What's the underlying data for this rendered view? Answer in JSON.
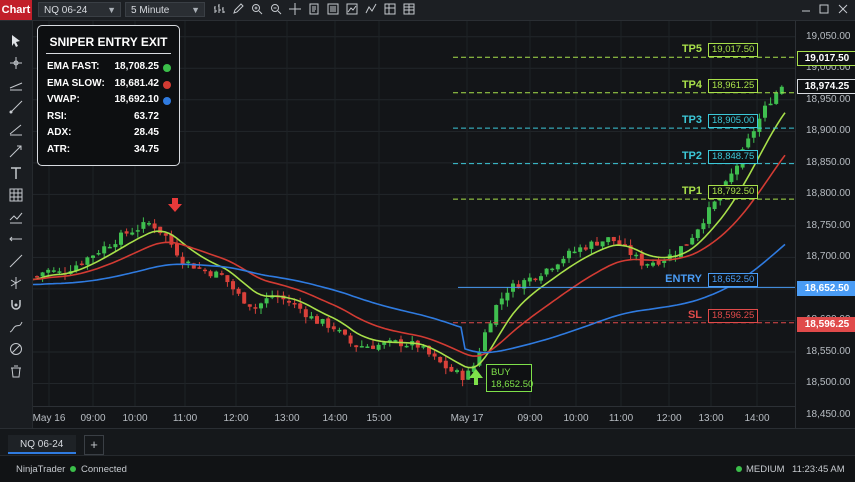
{
  "toolbar": {
    "chart_tab": "Chart",
    "instrument": "NQ 06-24",
    "interval": "5 Minute",
    "icons": [
      "bar-type-icon",
      "pencil-icon",
      "zoom-in-icon",
      "zoom-out-icon",
      "crosshair-icon",
      "template-icon",
      "properties-icon",
      "indicators-icon",
      "strategy-icon",
      "data-box-icon",
      "price-ladder-icon"
    ]
  },
  "window_controls": [
    "minimize-icon",
    "maximize-icon",
    "close-icon"
  ],
  "drawing_tools": [
    "pointer-icon",
    "crosshair-tool-icon",
    "line-tool-icon",
    "ray-tool-icon",
    "extended-line-icon",
    "arrow-line-icon",
    "text-tool-icon",
    "grid-tool-icon",
    "chart-style-icon",
    "horizontal-line-icon",
    "trend-line-icon",
    "fibonacci-icon",
    "magnet-icon",
    "pen-icon",
    "hide-icon",
    "delete-icon"
  ],
  "indicator_box": {
    "title": "SNIPER ENTRY EXIT",
    "rows": [
      {
        "label": "EMA FAST:",
        "value": "18,708.25",
        "dot": "#3bbf4a"
      },
      {
        "label": "EMA SLOW:",
        "value": "18,681.42",
        "dot": "#d23b33"
      },
      {
        "label": "VWAP:",
        "value": "18,692.10",
        "dot": "#2f7be0"
      },
      {
        "label": "RSI:",
        "value": "63.72"
      },
      {
        "label": "ADX:",
        "value": "28.45"
      },
      {
        "label": "ATR:",
        "value": "34.75"
      }
    ]
  },
  "levels": [
    {
      "name": "TP5",
      "price": "19,017.50",
      "tag": "19,017.50",
      "color": "#a8e04a",
      "style": "dashed"
    },
    {
      "name": "TP4",
      "price": "18,961.25",
      "color": "#a8e04a",
      "style": "dashed"
    },
    {
      "name": "TP3",
      "price": "18,905.00",
      "color": "#3cc8d8",
      "style": "dashed"
    },
    {
      "name": "TP2",
      "price": "18,848.75",
      "color": "#3cc8d8",
      "style": "dashed"
    },
    {
      "name": "TP1",
      "price": "18,792.50",
      "color": "#a8e04a",
      "style": "dashed"
    },
    {
      "name": "ENTRY",
      "price": "18,652.50",
      "tag": "18,652.50",
      "color": "#4a9cf5",
      "style": "solid"
    },
    {
      "name": "SL",
      "price": "18,596.25",
      "tag": "18,596.25",
      "color": "#e04a4a",
      "style": "dashed"
    }
  ],
  "buy_signal": {
    "label": "BUY",
    "price": "18,652.50",
    "color": "#7ee04a"
  },
  "sell_arrow_color": "#e83a3a",
  "last_price_tag": "18,974.25",
  "chart_data": {
    "type": "candlestick",
    "instrument": "NQ 06-24",
    "interval": "5 Minute",
    "ylim": [
      18450,
      19075
    ],
    "yticks": [
      "19,050.00",
      "19,000.00",
      "18,950.00",
      "18,900.00",
      "18,850.00",
      "18,800.00",
      "18,750.00",
      "18,700.00",
      "18,650.00",
      "18,600.00",
      "18,550.00",
      "18,500.00",
      "18,450.00"
    ],
    "xticks": [
      "May 16",
      "09:00",
      "10:00",
      "11:00",
      "12:00",
      "13:00",
      "14:00",
      "15:00",
      "May 17",
      "09:00",
      "10:00",
      "11:00",
      "12:00",
      "13:00",
      "14:00"
    ],
    "series": [
      {
        "name": "EMA FAST",
        "color": "#a8e04a"
      },
      {
        "name": "EMA SLOW",
        "color": "#d23b33"
      },
      {
        "name": "VWAP",
        "color": "#2f7be0"
      }
    ]
  },
  "bottom_tabs": {
    "active": "NQ 06-24",
    "add": "+"
  },
  "status": {
    "app": "NinjaTrader",
    "connection": "Connected",
    "priority": "MEDIUM",
    "time": "11:23:45 AM"
  }
}
